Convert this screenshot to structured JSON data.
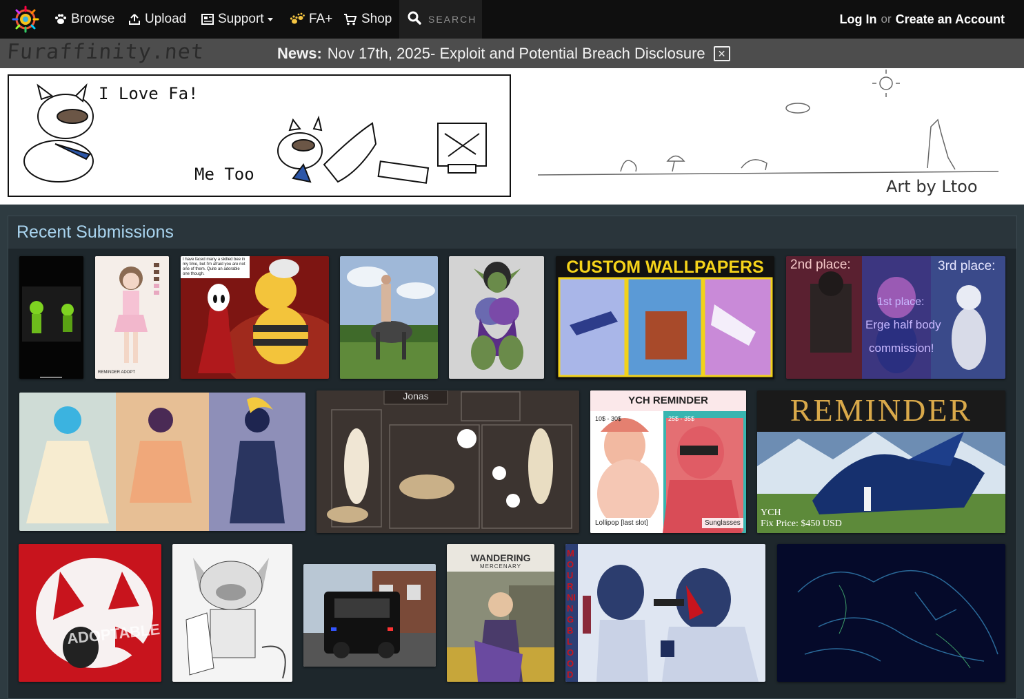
{
  "nav": {
    "browse": "Browse",
    "upload": "Upload",
    "support": "Support",
    "faplus": "FA+",
    "shop": "Shop",
    "search_placeholder": "SEARCH",
    "login": "Log In",
    "or": "or",
    "create_account": "Create an Account"
  },
  "site": {
    "wordmark": "Furaffinity.net"
  },
  "news": {
    "label": "News:",
    "text": "Nov 17th, 2025- Exploit and Potential Breach Disclosure"
  },
  "banner": {
    "speech_1": "I Love Fa!",
    "speech_2": "Me Too",
    "credit": "Art by Ltoo"
  },
  "recent": {
    "title": "Recent Submissions",
    "thumb_texts": {
      "hollow_knight_quote": "I have faced many a skilled bee in my time, but I'm afraid you are not one of them. Quite an adorable one though.",
      "custom_wallpapers": "CUSTOM WALLPAPERS",
      "second_place": "2nd place:",
      "third_place": "3rd place:",
      "first_place": "1st place:",
      "erge_half": "Erge half body",
      "commission": "commission!",
      "reminder_adopt": "REMINDER ADOPT",
      "jonas": "Jonas",
      "ych_reminder": "YCH REMINDER",
      "price_left": "10$ - 30$",
      "price_right": "25$ - 35$",
      "lollipop": "Lollipop [last slot]",
      "sunglasses": "Sunglasses",
      "reminder_big": "REMINDER",
      "ych": "YCH",
      "fix_price": "Fix Price: $450 USD",
      "adoptable": "ADOPTABLE",
      "wandering": "WANDERING",
      "mercenary": "MERCENARY",
      "mourning_blood": "MOURNING BLOOD"
    }
  },
  "colors": {
    "nav_bg": "#0f0f0f",
    "news_bg": "#4d4d4d",
    "page_bg": "#2e3b41",
    "section_bg": "#1e272c",
    "title": "#a9d4ef"
  }
}
